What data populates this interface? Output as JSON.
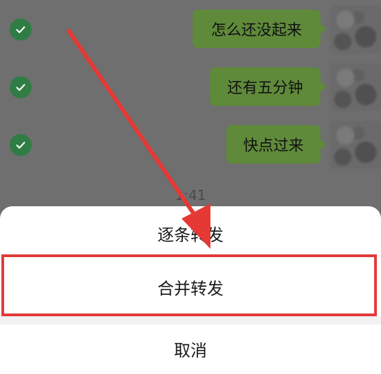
{
  "messages": [
    {
      "text": "怎么还没起来",
      "selected": true
    },
    {
      "text": "还有五分钟",
      "selected": true
    },
    {
      "text": "快点过来",
      "selected": true
    }
  ],
  "timestamp": "1:41",
  "sheet": {
    "option_one": "逐条转发",
    "option_two": "合并转发",
    "cancel": "取消"
  },
  "colors": {
    "bubble": "#5f8a3a",
    "check": "#2f7d45",
    "highlight": "#e33a3a",
    "arrow": "#e53935"
  }
}
